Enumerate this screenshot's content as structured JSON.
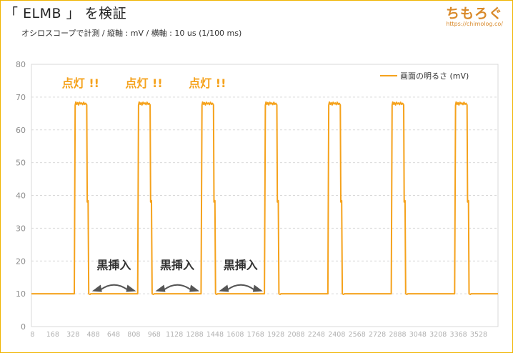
{
  "header": {
    "title": "「 ELMB 」 を検証",
    "subtitle": "オシロスコープで計測 / 縦軸 : mV / 横軸 : 10 us (1/100 ms)",
    "logo_text": "ちもろぐ",
    "logo_url": "https://chimolog.co/"
  },
  "chart_data": {
    "type": "line",
    "x_tick_labels": [
      "8",
      "168",
      "328",
      "488",
      "648",
      "808",
      "968",
      "1128",
      "1288",
      "1448",
      "1608",
      "1768",
      "1928",
      "2088",
      "2248",
      "2408",
      "2568",
      "2728",
      "2888",
      "3048",
      "3208",
      "3368",
      "3528"
    ],
    "y_ticks": [
      0,
      10,
      20,
      30,
      40,
      50,
      60,
      70,
      80
    ],
    "xlim": [
      0,
      3680
    ],
    "ylim": [
      0,
      80
    ],
    "grid": true,
    "legend_position": "top-right",
    "series": [
      {
        "name": "画面の明るさ (mV)",
        "color": "#f5a21c",
        "x": [
          0,
          338,
          345,
          350,
          358,
          365,
          372,
          380,
          388,
          396,
          404,
          412,
          420,
          428,
          436,
          440,
          447,
          452,
          462,
          468,
          838,
          845,
          850,
          858,
          865,
          872,
          880,
          888,
          896,
          904,
          912,
          920,
          928,
          936,
          940,
          947,
          952,
          962,
          968,
          1338,
          1345,
          1350,
          1358,
          1365,
          1372,
          1380,
          1388,
          1396,
          1404,
          1412,
          1420,
          1428,
          1436,
          1440,
          1447,
          1452,
          1462,
          1468,
          1838,
          1845,
          1850,
          1858,
          1865,
          1872,
          1880,
          1888,
          1896,
          1904,
          1912,
          1920,
          1928,
          1936,
          1940,
          1947,
          1952,
          1962,
          1968,
          2338,
          2345,
          2350,
          2358,
          2365,
          2372,
          2380,
          2388,
          2396,
          2404,
          2412,
          2420,
          2428,
          2436,
          2440,
          2447,
          2452,
          2462,
          2468,
          2838,
          2845,
          2850,
          2858,
          2865,
          2872,
          2880,
          2888,
          2896,
          2904,
          2912,
          2920,
          2928,
          2936,
          2940,
          2947,
          2952,
          2962,
          2968,
          3338,
          3345,
          3350,
          3358,
          3365,
          3372,
          3380,
          3388,
          3396,
          3404,
          3412,
          3420,
          3428,
          3436,
          3440,
          3447,
          3452,
          3462,
          3468,
          3680
        ],
        "y": [
          10,
          10,
          67.5,
          68.5,
          67.8,
          68.3,
          67.6,
          68.4,
          67.9,
          68.2,
          67.7,
          68.4,
          67.8,
          68.1,
          67.6,
          38,
          38.4,
          10,
          9.8,
          10,
          10,
          67.5,
          68.5,
          67.8,
          68.3,
          67.6,
          68.4,
          67.9,
          68.2,
          67.7,
          68.4,
          67.8,
          68.1,
          67.6,
          38,
          38.4,
          10,
          9.8,
          10,
          10,
          67.5,
          68.5,
          67.8,
          68.3,
          67.6,
          68.4,
          67.9,
          68.2,
          67.7,
          68.4,
          67.8,
          68.1,
          67.6,
          38,
          38.4,
          10,
          9.8,
          10,
          10,
          67.5,
          68.5,
          67.8,
          68.3,
          67.6,
          68.4,
          67.9,
          68.2,
          67.7,
          68.4,
          67.8,
          68.1,
          67.6,
          38,
          38.4,
          10,
          9.8,
          10,
          10,
          67.5,
          68.5,
          67.8,
          68.3,
          67.6,
          68.4,
          67.9,
          68.2,
          67.7,
          68.4,
          67.8,
          68.1,
          67.6,
          38,
          38.4,
          10,
          9.8,
          10,
          10,
          67.5,
          68.5,
          67.8,
          68.3,
          67.6,
          68.4,
          67.9,
          68.2,
          67.7,
          68.4,
          67.8,
          68.1,
          67.6,
          38,
          38.4,
          10,
          9.8,
          10,
          10,
          67.5,
          68.5,
          67.8,
          68.3,
          67.6,
          68.4,
          67.9,
          68.2,
          67.7,
          68.4,
          67.8,
          68.1,
          67.6,
          38,
          38.4,
          10,
          9.8,
          10,
          10
        ]
      }
    ],
    "annotations": {
      "on_labels": [
        {
          "text": "点灯 !!",
          "x": 388,
          "y": 73
        },
        {
          "text": "点灯 !!",
          "x": 888,
          "y": 73
        },
        {
          "text": "点灯 !!",
          "x": 1388,
          "y": 73
        }
      ],
      "insert_labels": [
        {
          "text": "黒挿入",
          "x": 650,
          "y": 17.5,
          "x_from": 478,
          "x_to": 825
        },
        {
          "text": "黒挿入",
          "x": 1150,
          "y": 17.5,
          "x_from": 978,
          "x_to": 1325
        },
        {
          "text": "黒挿入",
          "x": 1650,
          "y": 17.5,
          "x_from": 1478,
          "x_to": 1825
        }
      ],
      "label_color": "#f5a21c",
      "insert_color": "#333333"
    }
  }
}
